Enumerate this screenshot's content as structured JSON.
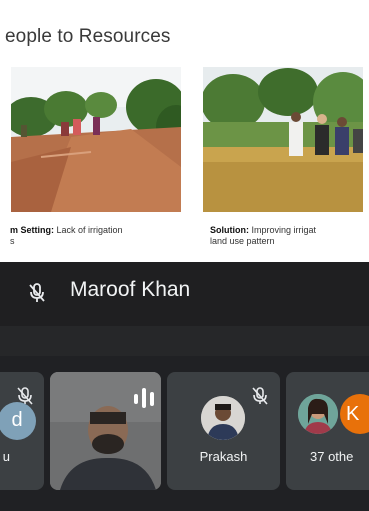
{
  "slide": {
    "title": "eople to Resources",
    "captions": [
      {
        "label": "m Setting:",
        "text": " Lack of irrigation",
        "line2": "s"
      },
      {
        "label": "Solution:",
        "text": " Improving irrigat",
        "line2": "land use pattern"
      }
    ]
  },
  "meeting": {
    "active_speaker": "Maroof Khan",
    "participants": [
      {
        "initial": "d",
        "label": "u"
      },
      {
        "label": ""
      },
      {
        "label": "Prakash"
      },
      {
        "initial": "K",
        "label": "37 othe"
      }
    ]
  },
  "colors": {
    "meet_bg": "#202124",
    "speaker_bar": "#1f1f21",
    "tile_bg": "#3c4043",
    "badge_orange": "#e8710a"
  }
}
